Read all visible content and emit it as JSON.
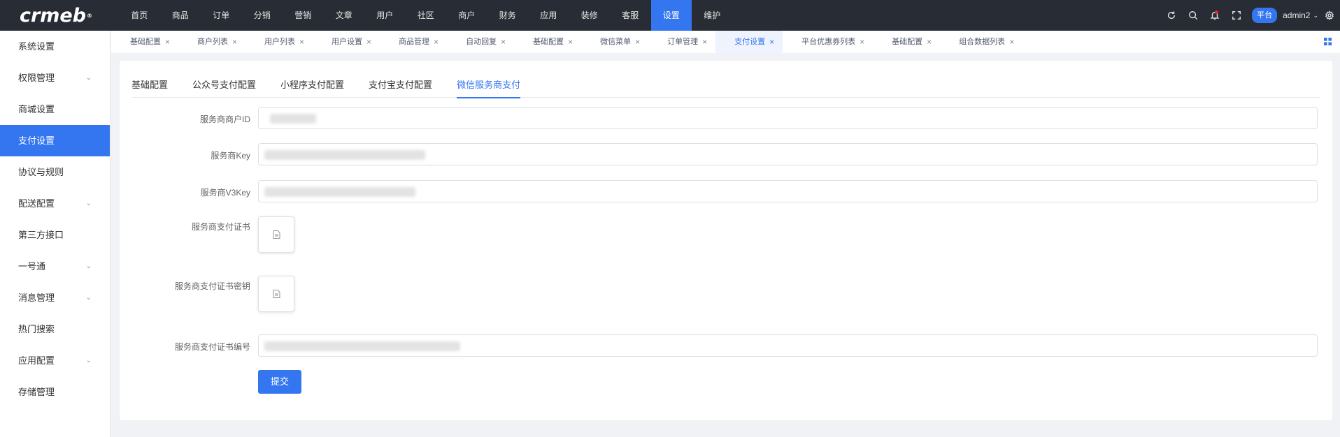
{
  "app": {
    "logo": "crmeb",
    "logo_mark": "®"
  },
  "topnav": {
    "items": [
      "首页",
      "商品",
      "订单",
      "分销",
      "营销",
      "文章",
      "用户",
      "社区",
      "商户",
      "财务",
      "应用",
      "装修",
      "客服",
      "设置",
      "维护"
    ],
    "active_index": 13
  },
  "topright": {
    "platform": "平台",
    "user": "admin2",
    "user_chevron": "⌄",
    "icons": [
      "refresh-icon",
      "search-icon",
      "bell-icon",
      "fullscreen-icon",
      "settings-icon"
    ]
  },
  "sidebar": {
    "items": [
      {
        "label": "系统设置",
        "arrow": ""
      },
      {
        "label": "权限管理",
        "arrow": "⌄"
      },
      {
        "label": "商城设置",
        "arrow": ""
      },
      {
        "label": "支付设置",
        "arrow": ""
      },
      {
        "label": "协议与规则",
        "arrow": ""
      },
      {
        "label": "配送配置",
        "arrow": "⌄"
      },
      {
        "label": "第三方接口",
        "arrow": ""
      },
      {
        "label": "一号通",
        "arrow": "⌄"
      },
      {
        "label": "消息管理",
        "arrow": "⌄"
      },
      {
        "label": "热门搜索",
        "arrow": ""
      },
      {
        "label": "应用配置",
        "arrow": "⌄"
      },
      {
        "label": "存储管理",
        "arrow": ""
      }
    ],
    "active_index": 3
  },
  "tabs": {
    "items": [
      "基础配置",
      "商户列表",
      "用户列表",
      "用户设置",
      "商品管理",
      "自动回复",
      "基础配置",
      "微信菜单",
      "订单管理",
      "支付设置",
      "平台优惠券列表",
      "基础配置",
      "组合数据列表"
    ],
    "active_index": 9,
    "close": "×"
  },
  "subtabs": {
    "items": [
      "基础配置",
      "公众号支付配置",
      "小程序支付配置",
      "支付宝支付配置",
      "微信服务商支付"
    ],
    "active_index": 4
  },
  "form": {
    "merchant_id_label": "服务商商户ID",
    "key_label": "服务商Key",
    "v3key_label": "服务商V3Key",
    "cert_label": "服务商支付证书",
    "cert_key_label": "服务商支付证书密钥",
    "cert_serial_label": "服务商支付证书编号",
    "submit_label": "提交"
  },
  "colors": {
    "primary": "#3476f0",
    "topbar": "#282c34"
  }
}
